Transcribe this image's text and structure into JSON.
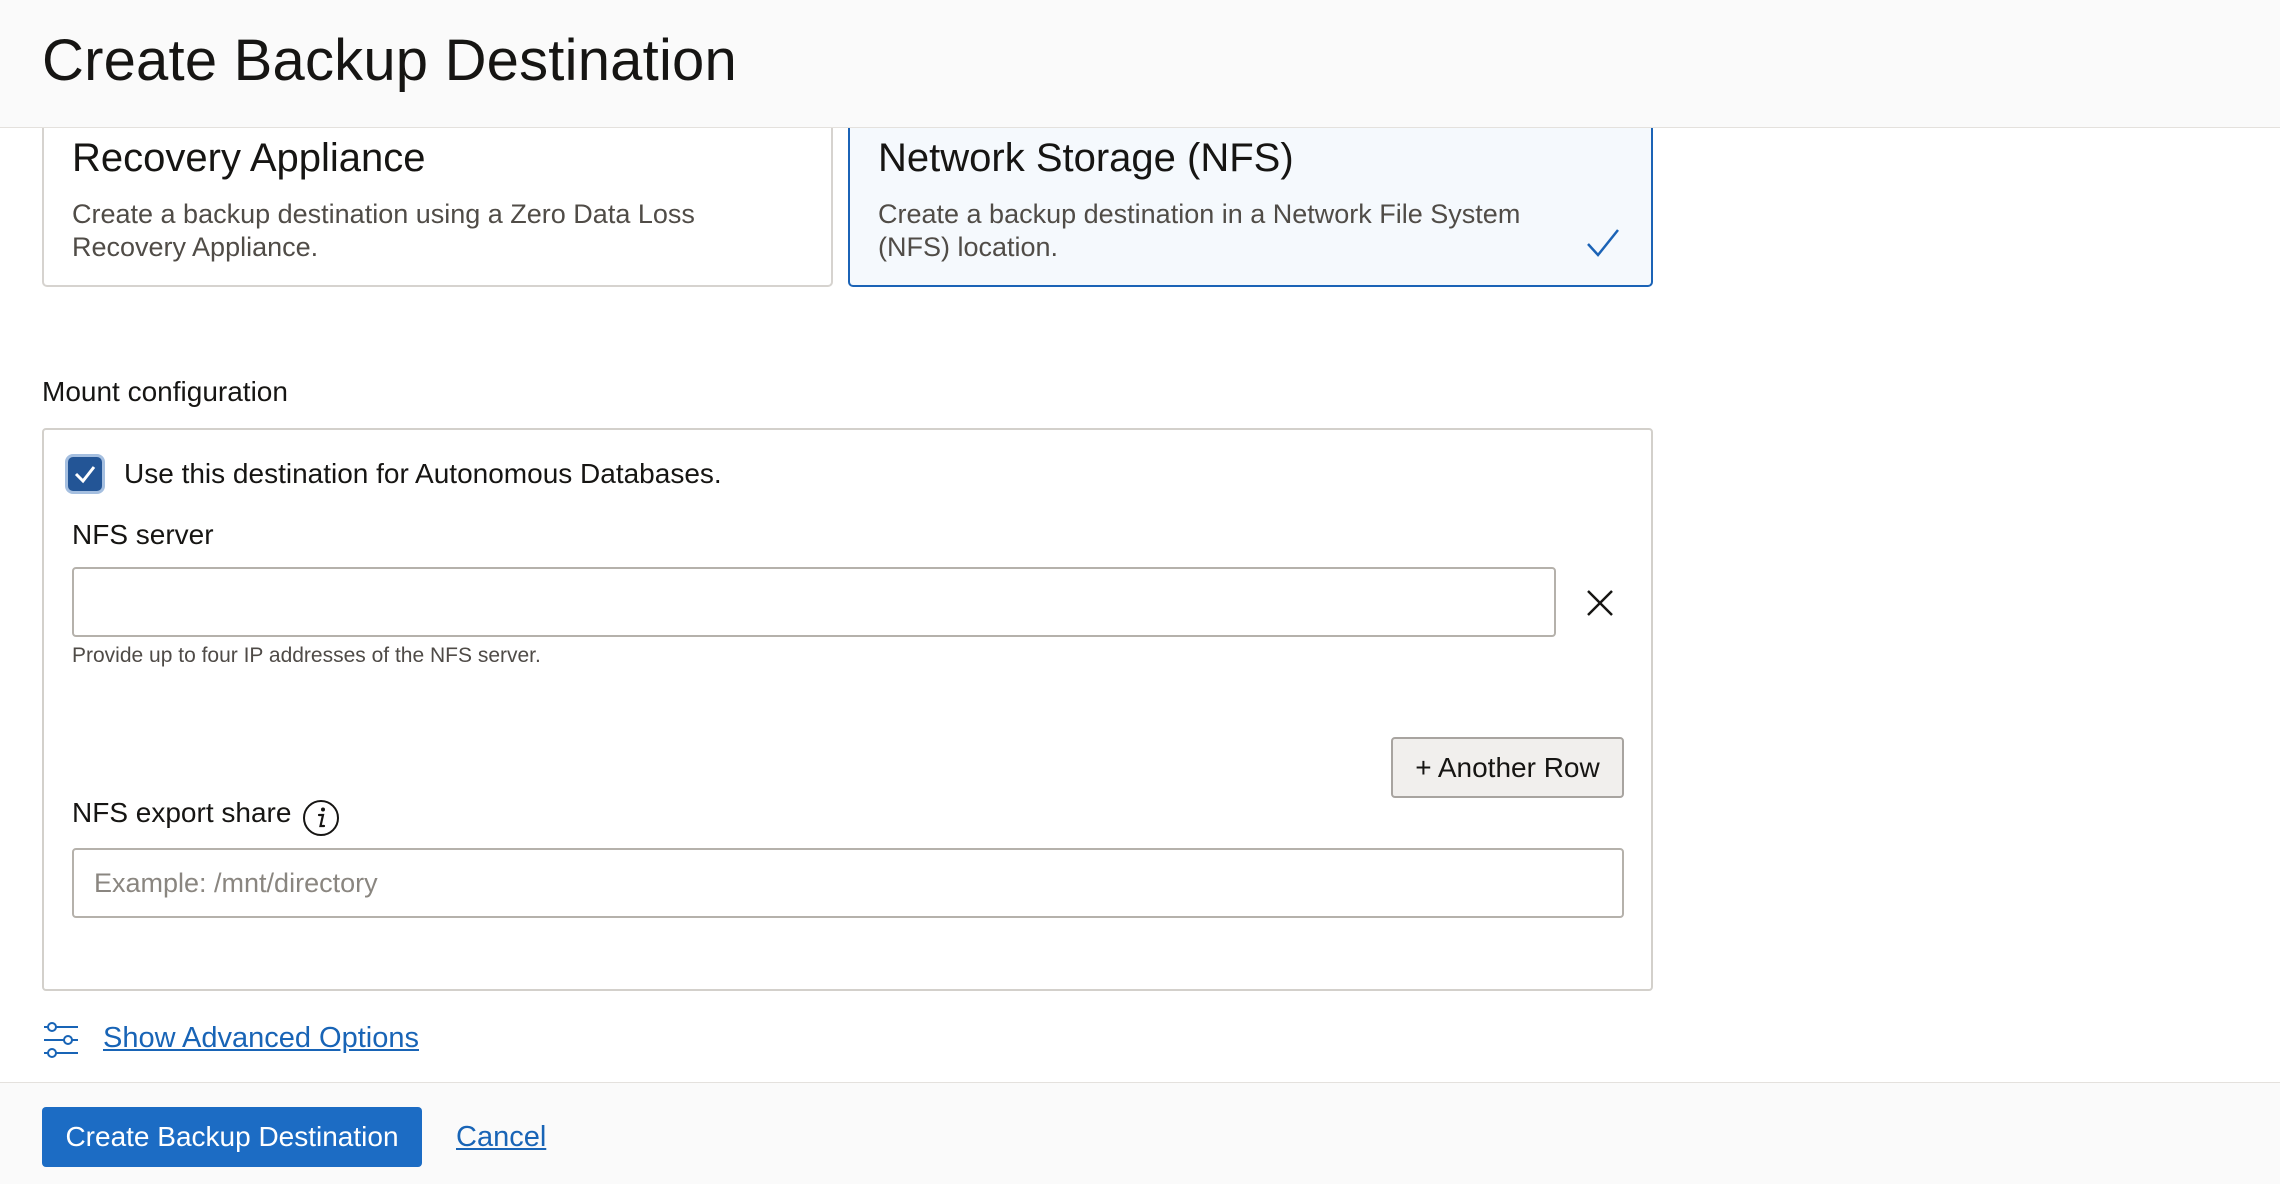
{
  "page": {
    "title": "Create Backup Destination"
  },
  "destination_types": [
    {
      "title": "Recovery Appliance",
      "description": "Create a backup destination using a Zero Data Loss Recovery Appliance.",
      "selected": false
    },
    {
      "title": "Network Storage (NFS)",
      "description": "Create a backup destination in a Network File System (NFS) location.",
      "selected": true
    }
  ],
  "mount_configuration": {
    "section_label": "Mount configuration",
    "autonomous_checkbox": {
      "label": "Use this destination for Autonomous Databases.",
      "checked": true
    },
    "nfs_server": {
      "label": "NFS server",
      "value": "",
      "help_text": "Provide up to four IP addresses of the NFS server."
    },
    "another_row_label": "+ Another Row",
    "nfs_export_share": {
      "label": "NFS export share",
      "placeholder": "Example: /mnt/directory",
      "value": ""
    }
  },
  "advanced_options_label": "Show Advanced Options",
  "footer": {
    "create_label": "Create Backup Destination",
    "cancel_label": "Cancel"
  },
  "colors": {
    "primary": "#1c6cc4",
    "link": "#1864b6",
    "selected_border": "#1b63b6",
    "checkbox": "#235596"
  },
  "icons": {
    "selected_card": "check-icon",
    "remove_row": "close-icon",
    "field_info": "info-icon",
    "advanced_options": "sliders-icon"
  }
}
